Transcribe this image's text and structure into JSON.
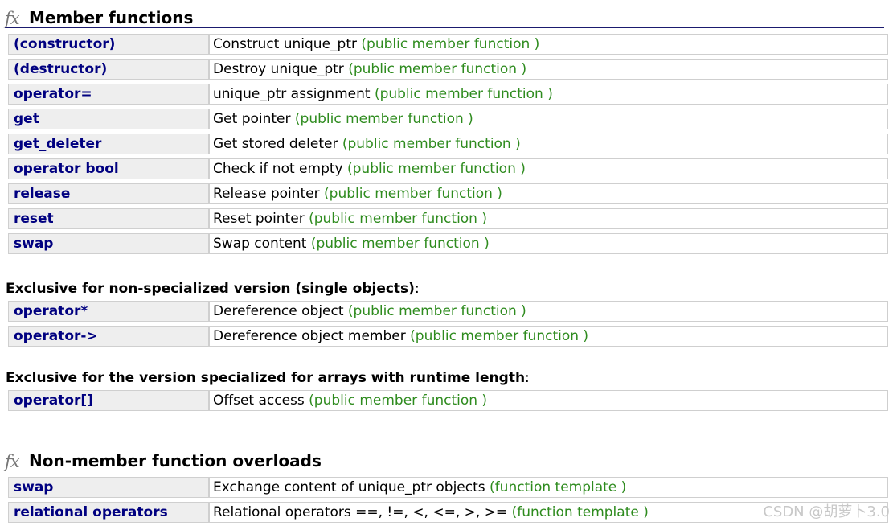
{
  "member_section": {
    "icon": "fx-icon",
    "title": "Member functions",
    "rows": [
      {
        "name": "(constructor)",
        "desc": "Construct unique_ptr",
        "kind": "(public member function )"
      },
      {
        "name": "(destructor)",
        "desc": "Destroy unique_ptr",
        "kind": "(public member function )"
      },
      {
        "name": "operator=",
        "desc": "unique_ptr assignment",
        "kind": "(public member function )"
      },
      {
        "name": "get",
        "desc": "Get pointer",
        "kind": "(public member function )"
      },
      {
        "name": "get_deleter",
        "desc": "Get stored deleter",
        "kind": "(public member function )"
      },
      {
        "name": "operator bool",
        "desc": "Check if not empty",
        "kind": "(public member function )"
      },
      {
        "name": "release",
        "desc": "Release pointer",
        "kind": "(public member function )"
      },
      {
        "name": "reset",
        "desc": "Reset pointer",
        "kind": "(public member function )"
      },
      {
        "name": "swap",
        "desc": "Swap content",
        "kind": "(public member function )"
      }
    ]
  },
  "single_section": {
    "heading": "Exclusive for non-specialized version (single objects)",
    "colon": ":",
    "rows": [
      {
        "name": "operator*",
        "desc": "Dereference object",
        "kind": "(public member function )"
      },
      {
        "name": "operator->",
        "desc": "Dereference object member",
        "kind": "(public member function )"
      }
    ]
  },
  "array_section": {
    "heading": "Exclusive for the version specialized for arrays with runtime length",
    "colon": ":",
    "rows": [
      {
        "name": "operator[]",
        "desc": "Offset access",
        "kind": "(public member function )"
      }
    ]
  },
  "nonmember_section": {
    "icon": "fx-icon",
    "title": "Non-member function overloads",
    "rows": [
      {
        "name": "swap",
        "desc": "Exchange content of unique_ptr objects",
        "kind": "(function template )"
      },
      {
        "name": "relational operators",
        "desc": "Relational operators ==, !=, <, <=, >, >=",
        "kind": "(function template )"
      }
    ]
  },
  "watermark": "CSDN @胡萝卜3.0",
  "colors": {
    "link": "#000080",
    "kind": "#2e8b1e",
    "name_bg": "#eeeeee",
    "border": "#cfcfcf"
  }
}
